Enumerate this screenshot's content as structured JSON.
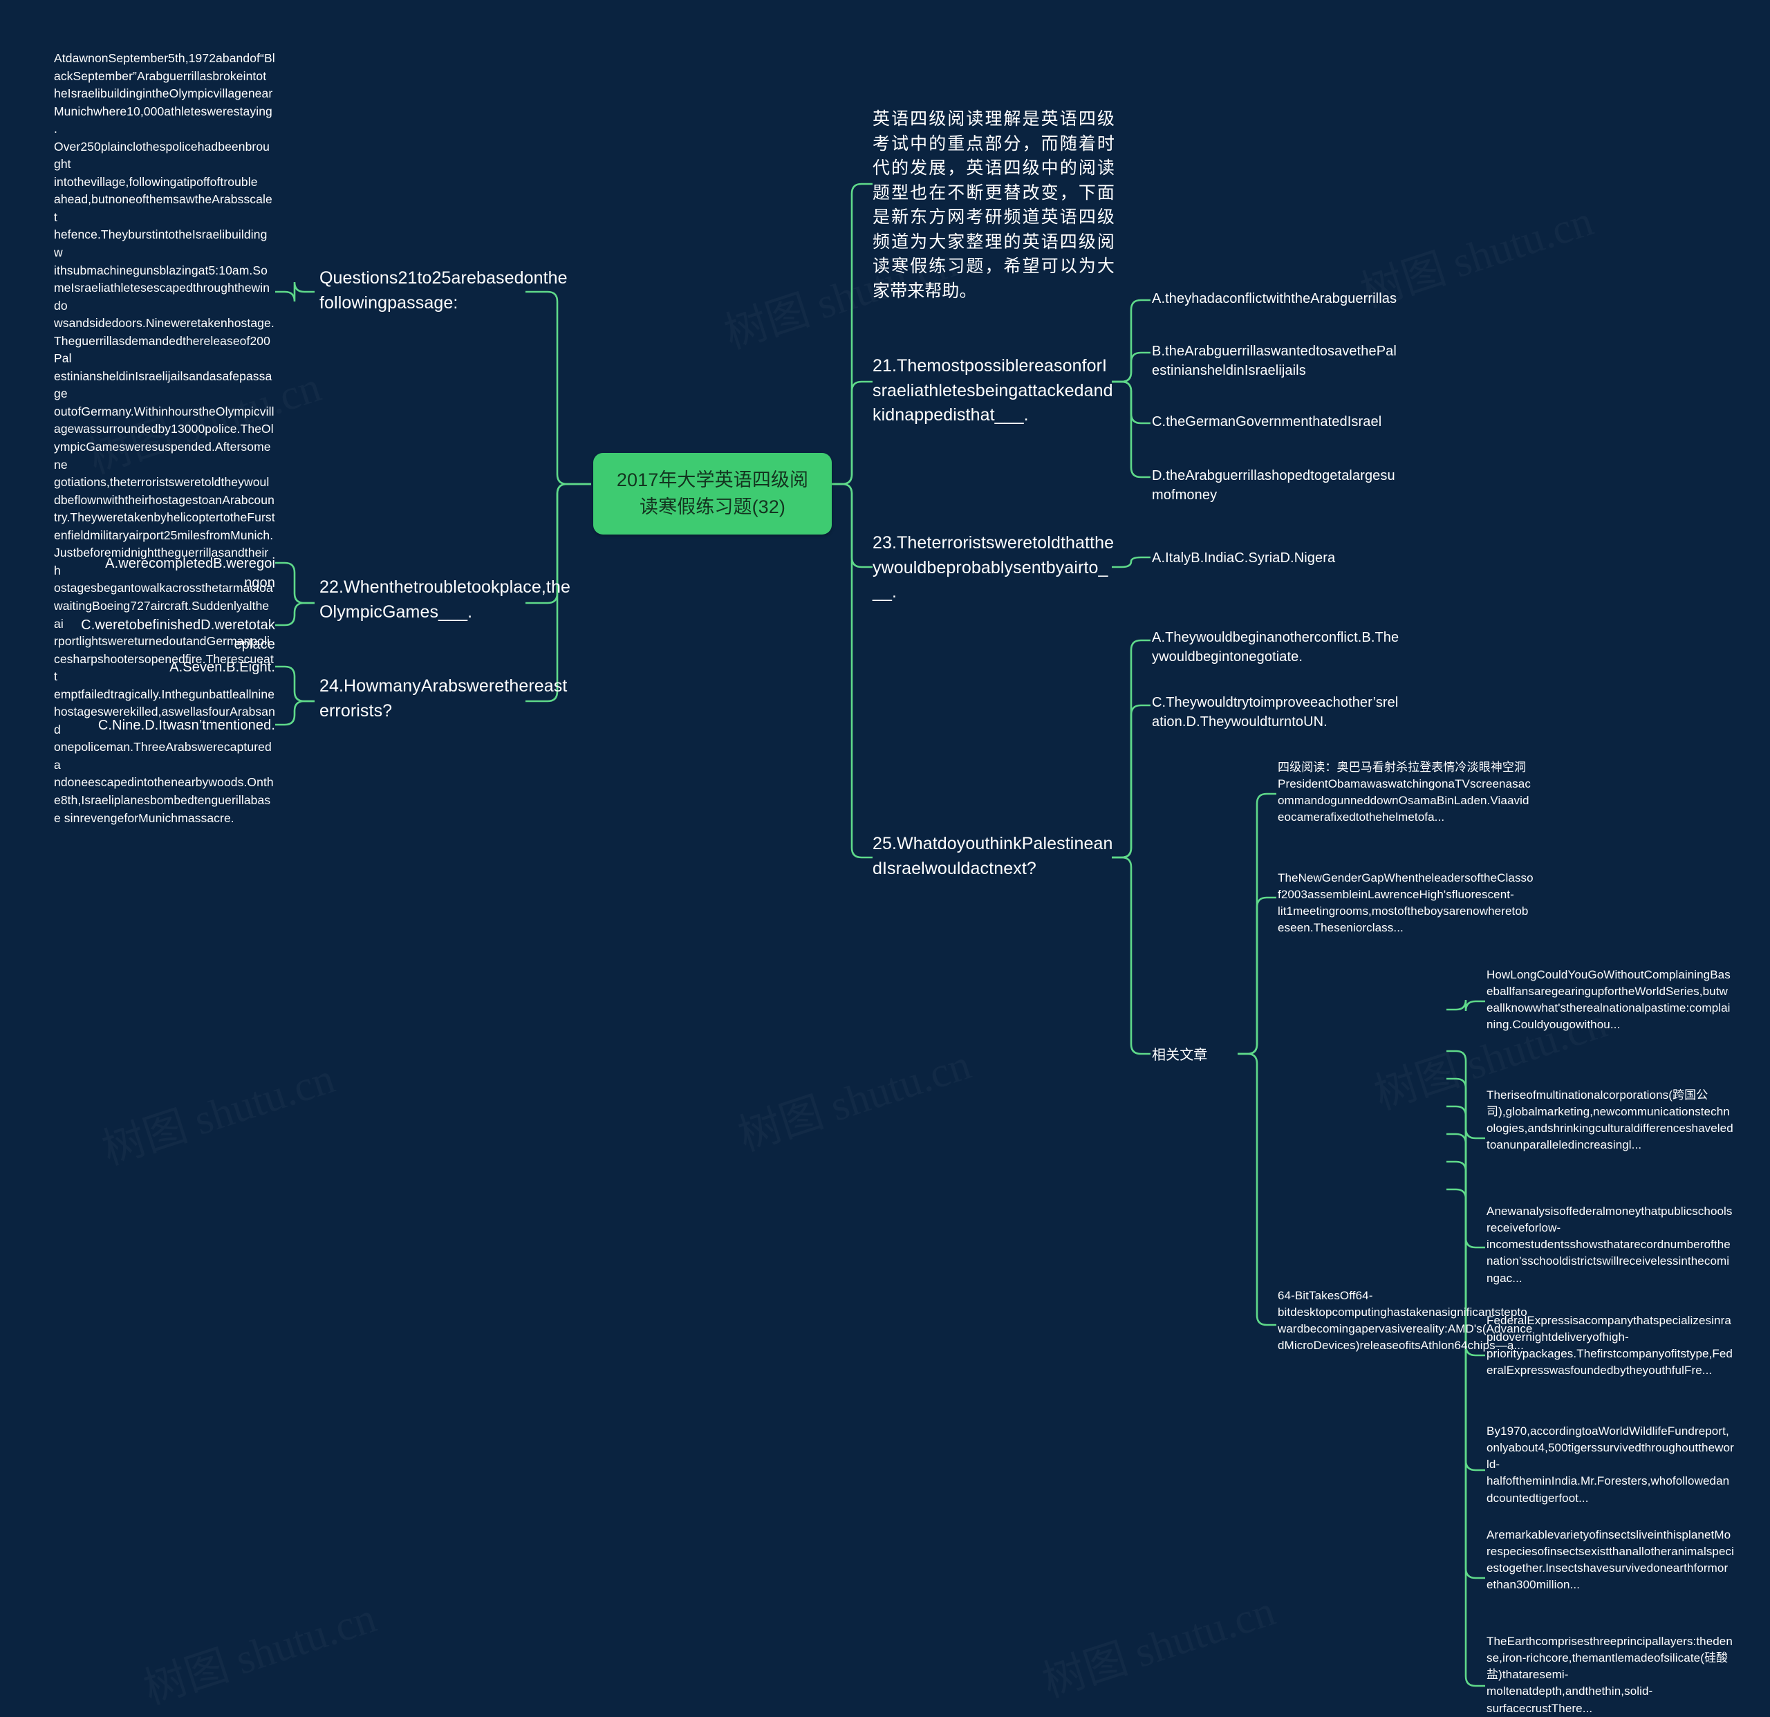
{
  "theme": {
    "background": "#0a2340",
    "branch_color": "#5fd98a",
    "root_fill": "#3ecb71",
    "root_text": "#13341f",
    "node_text": "#ffffff"
  },
  "watermark": "树图 shutu.cn",
  "root": {
    "label": "2017年大学英语四级阅读寒假练习题(32)"
  },
  "left_branch": {
    "heading": "Questions21to25arebasedonthefollowingpassage:",
    "passage": "AtdawnonSeptember5th,1972abandof“BlackSeptember”Arabguerrillasbrokeintot heIsraelibuildingintheOlympicvillagenear Munichwhere10,000athleteswerestaying. Over250plainclothespolicehadbeenbrought intothevillage,followingatipoffoftrouble ahead,butnoneofthemsawtheArabsscalet hefence.TheyburstintotheIsraelibuildingw ithsubmachinegunsblazingat5:10am.SomeIsraeliathletesescapedthroughthewindo wsandsidedoors.Nineweretakenhostage.Theguerrillasdemandedthereleaseof200Pal estiniansheldinIsraelijailsandasafepassage outofGermany.WithinhourstheOlympicvill agewassurroundedby13000police.TheOlympicGamesweresuspended.Aftersomene gotiations,theterroristsweretoldtheywoul dbeflownwiththeirhostagestoanArabcoun try.TheyweretakenbyhelicoptertotheFurst enfieldmilitaryairport25milesfromMunich. Justbeforemidnighttheguerrillasandtheirh ostagesbegantowalkacrossthetarmactoa waitingBoeing727aircraft.Suddenlyaltheai rportlightswereturnedoutandGermanpoli cesharpshootersopenedfire.Therescueatt emptfailedtragically.Inthegunbattleallnine hostageswerekilled,aswellasfourArabsand onepoliceman.ThreeArabswerecaptureda ndoneescapedintothenearbywoods.Onth e8th,Israeliplanesbombedtenguerillabase sinrevengeforMunichmassacre.",
    "questions": [
      {
        "id": "q22",
        "text": "22.Whenthetroubletookplace,theOlympicGames___.",
        "options": [
          "A.werecompletedB.weregoingon",
          "C.weretobefinishedD.weretotakeplace"
        ]
      },
      {
        "id": "q24",
        "text": "24.HowmanyArabswerethereasterrorists?",
        "options": [
          "A.Seven.B.Eight.",
          "C.Nine.D.Itwasn’tmentioned."
        ]
      }
    ]
  },
  "right_branch": {
    "intro": "英语四级阅读理解是英语四级考试中的重点部分，而随着时代的发展，英语四级中的阅读题型也在不断更替改变，下面是新东方网考研频道英语四级频道为大家整理的英语四级阅读寒假练习题，希望可以为大家带来帮助。",
    "questions": [
      {
        "id": "q21",
        "text": "21.ThemostpossiblereasonforIsraeliathletesbeingattackedandkidnappedisthat___.",
        "options": [
          "A.theyhadaconflictwiththeArabguerrillas",
          "B.theArabguerrillaswantedtosavethePalestiniansheldinIsraelijails",
          "C.theGermanGovernmenthatedIsrael",
          "D.theArabguerrillashopedtogetalargesumofmoney"
        ]
      },
      {
        "id": "q23",
        "text": "23.Theterroristsweretoldthattheywouldbeprobablysentbyairto___.",
        "options": [
          "A.ItalyB.IndiaC.SyriaD.Nigera"
        ]
      },
      {
        "id": "q25",
        "text": "25.WhatdoyouthinkPalestineandIsraelwouldactnext?",
        "options": [
          "A.Theywouldbeginanotherconflict.B.Theywouldbegintonegotiate.",
          "C.Theywouldtrytoimproveeachother’srelation.D.TheywouldturntoUN."
        ]
      }
    ]
  },
  "related": {
    "label": "相关文章",
    "items": [
      "四级阅读：奥巴马看射杀拉登表情冷淡眼神空洞PresidentObamawaswatchingonaTVscreenasacommandogunneddownOsamaBinLaden.Viaavideocamerafixedtothehelmetofa...",
      "TheNewGenderGapWhentheleadersoftheClassof2003assembleinLawrenceHigh'sfluorescent-lit1meetingrooms,mostoftheboysarenowheretobeseen.Theseniorclass...",
      "64-BitTakesOff64-bitdesktopcomputinghastakenasignificantsteptowardbecomingapervasivereality:AMD's(AdvancedMicroDevices)releaseofitsAthlon64chips—a..."
    ],
    "sub_items": [
      "HowLongCouldYouGoWithoutComplainingBaseballfansaregearingupfortheWorldSeries,butweallknowwhat'stherealnationalpastime:complaining.Couldyougowithou...",
      "Theriseofmultinationalcorporations(跨国公司),globalmarketing,newcommunicationstechnologies,andshrinkingculturaldifferenceshaveledtoanunparalleledincreasingl...",
      "Anewanalysisoffederalmoneythatpublicschoolsreceiveforlow-incomestudentsshowsthatarecordnumberofthenation’sschooldistrictswillreceivelessinthecomingac...",
      "FederalExpressisacompanythatspecializesinrapidovernightdeliveryofhigh-prioritypackages.Thefirstcompanyofitstype,FederalExpresswasfoundedbytheyouthfulFre...",
      "By1970,accordingtoaWorldWildlifeFundreport,onlyabout4,500tigerssurvivedthroughouttheworld-halfoftheminIndia.Mr.Foresters,whofollowedandcountedtigerfoot...",
      "AremarkablevarietyofinsectsliveinthisplanetMorespeciesofinsectsexistthanallotheranimalspeciestogether.Insectshavesurvivedonearthformorethan300million...",
      "TheEarthcomprisesthreeprincipallayers:thedense,iron-richcore,themantlemadeofsilicate(硅酸盐)thataresemi-moltenatdepth,andthethin,solid-surfacecrustThere..."
    ]
  }
}
